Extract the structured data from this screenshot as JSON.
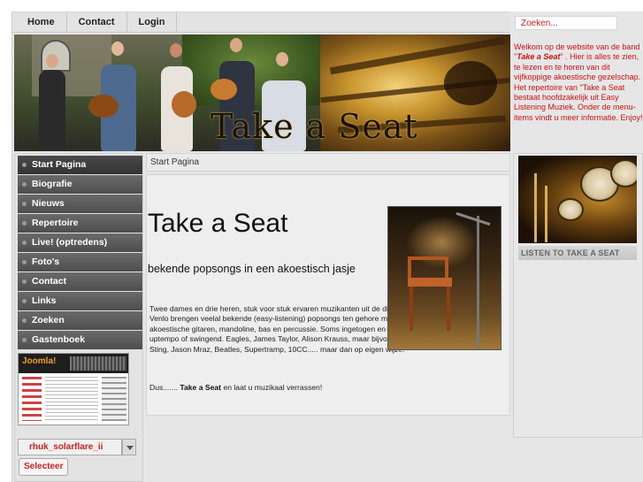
{
  "topnav": {
    "items": [
      {
        "label": "Home"
      },
      {
        "label": "Contact"
      },
      {
        "label": "Login"
      }
    ]
  },
  "search": {
    "placeholder": "Zoeken..."
  },
  "banner": {
    "title": "Take a Seat"
  },
  "welcome": {
    "part1": "Welkom op de website van de band \"",
    "band_name": "Take a Seat",
    "part2": "\" . Hier is alles te zien, te lezen en te horen van dit vijfkoppige akoestische gezelschap. Het repertoire van \"Take a Seat bestaat hoofdzakelijk uit Easy Listening Muziek. Onder de menu-items vindt u meer informatie. Enjoy!"
  },
  "sidebar": {
    "items": [
      {
        "label": "Start Pagina",
        "active": true
      },
      {
        "label": "Biografie"
      },
      {
        "label": "Nieuws"
      },
      {
        "label": "Repertoire"
      },
      {
        "label": "Live! (optredens)"
      },
      {
        "label": "Foto's"
      },
      {
        "label": "Contact"
      },
      {
        "label": "Links"
      },
      {
        "label": "Zoeken"
      },
      {
        "label": "Gastenboek"
      }
    ],
    "template_thumb_logo": "Joomla!",
    "template_select_value": "rhuk_solarflare_ii",
    "select_button_label": "Selecteer"
  },
  "breadcrumb": {
    "text": "Start Pagina"
  },
  "article": {
    "title": "Take a Seat",
    "subtitle": "bekende popsongs in een akoestisch jasje",
    "body": "Twee dames en drie heren, stuk voor stuk ervaren muzikanten uit de directe omgeving van Venlo brengen veelal bekende (easy-listening) popsongs ten gehore met veelstemmige zang, akoestische gitaren, mandoline, bas en percussie. Soms ingetogen en sfeervol, soms uptempo of swingend. Eagles, James Taylor, Alison Krauss, maar bijvoorbeeld ook R.E.M, Sting, Jason Mraz, Beatles, Supertramp, 10CC..... maar dan op eigen wijze.",
    "closing_prefix": "Dus....... ",
    "closing_bold": "Take a Seat",
    "closing_suffix": " en laat u muzikaal verrassen!"
  },
  "rightcol": {
    "listen_label": "LISTEN TO TAKE A SEAT"
  },
  "colors": {
    "accent_red": "#cc1111",
    "menu_bg": "#555555",
    "page_bg": "#e6e6e6"
  }
}
